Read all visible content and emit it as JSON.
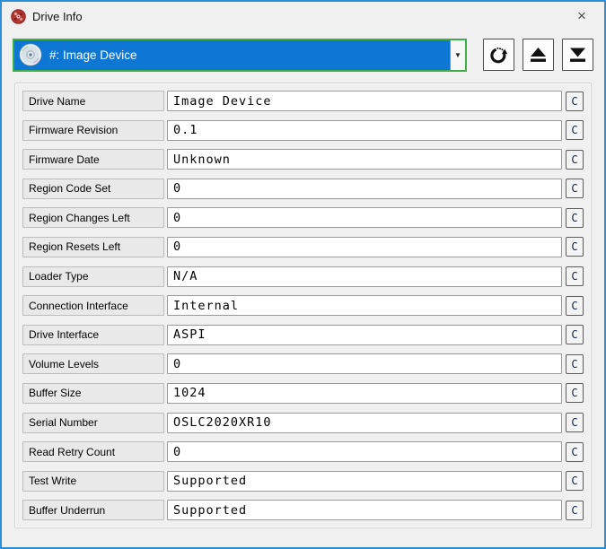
{
  "window": {
    "title": "Drive Info",
    "close_label": "×"
  },
  "drive_selector": {
    "selected": "#: Image Device",
    "arrow": "▼"
  },
  "toolbar": {
    "buttons": [
      "refresh-drive",
      "eject-tray",
      "load-tray"
    ]
  },
  "rows": [
    {
      "label": "Drive Name",
      "value": "Image Device"
    },
    {
      "label": "Firmware Revision",
      "value": "0.1"
    },
    {
      "label": "Firmware Date",
      "value": "Unknown"
    },
    {
      "label": "Region Code Set",
      "value": "0"
    },
    {
      "label": "Region Changes Left",
      "value": "0"
    },
    {
      "label": "Region Resets Left",
      "value": "0"
    },
    {
      "label": "Loader Type",
      "value": "N/A"
    },
    {
      "label": "Connection Interface",
      "value": "Internal"
    },
    {
      "label": "Drive Interface",
      "value": "ASPI"
    },
    {
      "label": "Volume Levels",
      "value": "0"
    },
    {
      "label": "Buffer Size",
      "value": "1024"
    },
    {
      "label": "Serial Number",
      "value": "OSLC2020XR10"
    },
    {
      "label": "Read Retry Count",
      "value": "0"
    },
    {
      "label": "Test Write",
      "value": "Supported"
    },
    {
      "label": "Buffer Underrun",
      "value": "Supported"
    }
  ],
  "copy_button_label": "C",
  "colors": {
    "accent_blue": "#0e77d3",
    "focus_green": "#3fae49",
    "window_border": "#2a8ed9",
    "window_bg": "#f0f0f0",
    "title_icon_red": "#b5342f"
  }
}
